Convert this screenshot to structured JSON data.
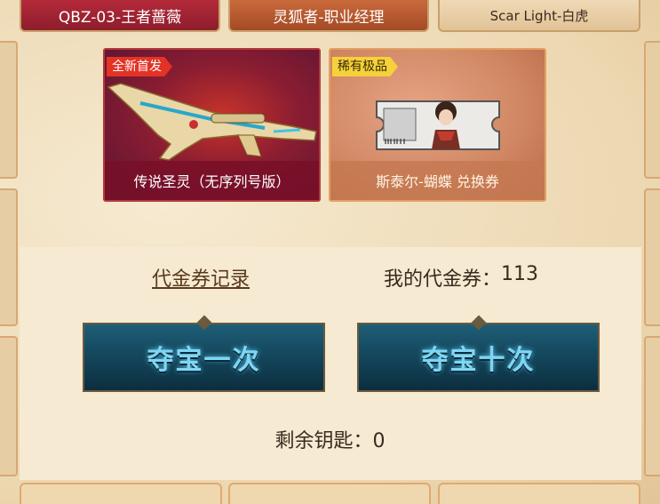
{
  "tabs": [
    {
      "label": "QBZ-03-王者蔷薇"
    },
    {
      "label": "灵狐者-职业经理"
    },
    {
      "label": "Scar Light-白虎"
    }
  ],
  "cards": [
    {
      "badge": "全新首发",
      "name": "传说圣灵（无序列号版）",
      "badge_color": "#e33326"
    },
    {
      "badge": "稀有极品",
      "name": "斯泰尔-蝴蝶 兑换券",
      "badge_color": "#f5d13a"
    }
  ],
  "record_link": "代金券记录",
  "coupon": {
    "label": "我的代金券：",
    "value": "113"
  },
  "buttons": {
    "once": "夺宝一次",
    "ten": "夺宝十次"
  },
  "keys": {
    "label": "剩余钥匙：",
    "value": "0"
  },
  "colors": {
    "accent": "#7fd6f2",
    "button_bg": "#154a60",
    "panel": "#f6ead3"
  }
}
